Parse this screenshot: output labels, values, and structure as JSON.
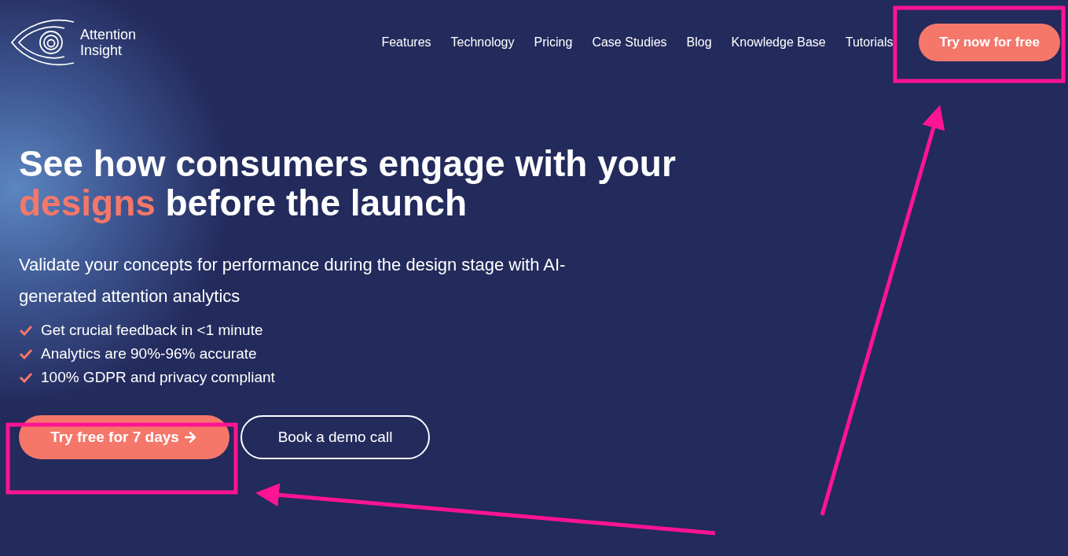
{
  "logo": {
    "line1": "Attention",
    "line2": "Insight"
  },
  "nav": {
    "links": [
      "Features",
      "Technology",
      "Pricing",
      "Case Studies",
      "Blog",
      "Knowledge Base",
      "Tutorials"
    ],
    "cta": "Try now for free"
  },
  "hero": {
    "title_lines": [
      [
        {
          "text": "See how consumers engage with your",
          "highlight": false
        }
      ],
      [
        {
          "text": "designs",
          "highlight": true
        },
        {
          "text": " before the launch",
          "highlight": false
        }
      ]
    ],
    "subtitle": "Validate your concepts for performance during the design stage with AI-generated attention analytics",
    "benefits": [
      "Get crucial feedback in <1 minute",
      "Analytics are 90%-96% accurate",
      "100% GDPR and privacy compliant"
    ],
    "primary_button": "Try free for 7 days",
    "secondary_button": "Book a demo call"
  }
}
